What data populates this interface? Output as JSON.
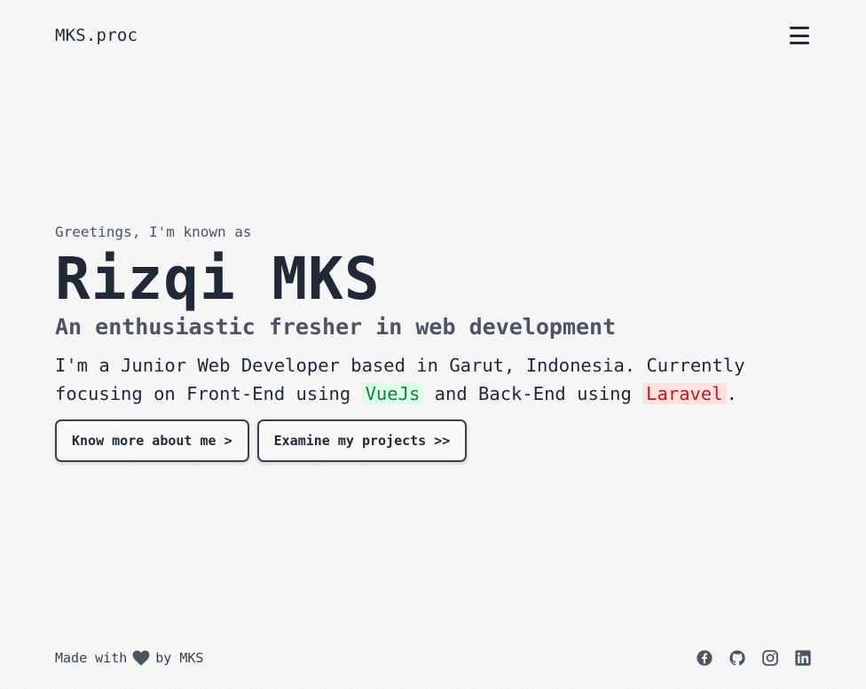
{
  "header": {
    "brand": "MKS.proc",
    "menu_icon": "hamburger-menu-icon"
  },
  "hero": {
    "greeting": "Greetings, I'm known as",
    "name": "Rizqi MKS",
    "tagline": "An enthusiastic fresher in web development",
    "intro_part1": "I'm a Junior Web Developer based in Garut, Indonesia. Currently focusing on Front-End using",
    "frontend_tech": "VueJs",
    "intro_part2": "and Back-End using",
    "backend_tech": "Laravel",
    "intro_end": "."
  },
  "actions": {
    "about_label": "Know more about me >",
    "projects_label": "Examine my projects >>"
  },
  "footer": {
    "made_with": "Made with",
    "by": "by MKS",
    "socials": [
      {
        "icon": "facebook-icon"
      },
      {
        "icon": "github-icon"
      },
      {
        "icon": "instagram-icon"
      },
      {
        "icon": "linkedin-icon"
      }
    ]
  },
  "colors": {
    "text_primary": "#1f2937",
    "text_secondary": "#4b5563",
    "vue_bg": "#dcfce7",
    "vue_text": "#15803d",
    "laravel_bg": "#fee2e2",
    "laravel_text": "#b91c1c"
  }
}
